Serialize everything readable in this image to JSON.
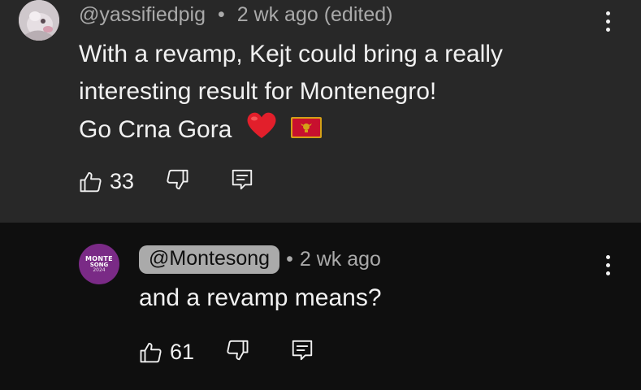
{
  "comments": [
    {
      "handle": "@yassifiedpig",
      "separator": "•",
      "time": "2 wk ago (edited)",
      "line1": "With a revamp, Kejt could bring a really interesting result for Montenegro!",
      "line2": "Go Crna Gora",
      "emojis": [
        "red-heart",
        "flag-montenegro"
      ],
      "likes": "33",
      "icons": {
        "like": "thumbs-up-icon",
        "dislike": "thumbs-down-icon",
        "reply": "reply-icon",
        "menu": "more-vert-icon"
      }
    },
    {
      "avatar_text": [
        "MONTE",
        "SONG",
        "2024"
      ],
      "handle": "@Montesong",
      "separator": "•",
      "time": "2 wk ago",
      "text": "and a revamp means?",
      "likes": "61",
      "icons": {
        "like": "thumbs-up-icon",
        "dislike": "thumbs-down-icon",
        "reply": "reply-icon",
        "menu": "more-vert-icon"
      }
    }
  ],
  "colors": {
    "parent_bg": "#282828",
    "reply_bg": "#0f0f0f",
    "meta_text": "#aaaaaa",
    "avatar_purple": "#7a2a86"
  }
}
